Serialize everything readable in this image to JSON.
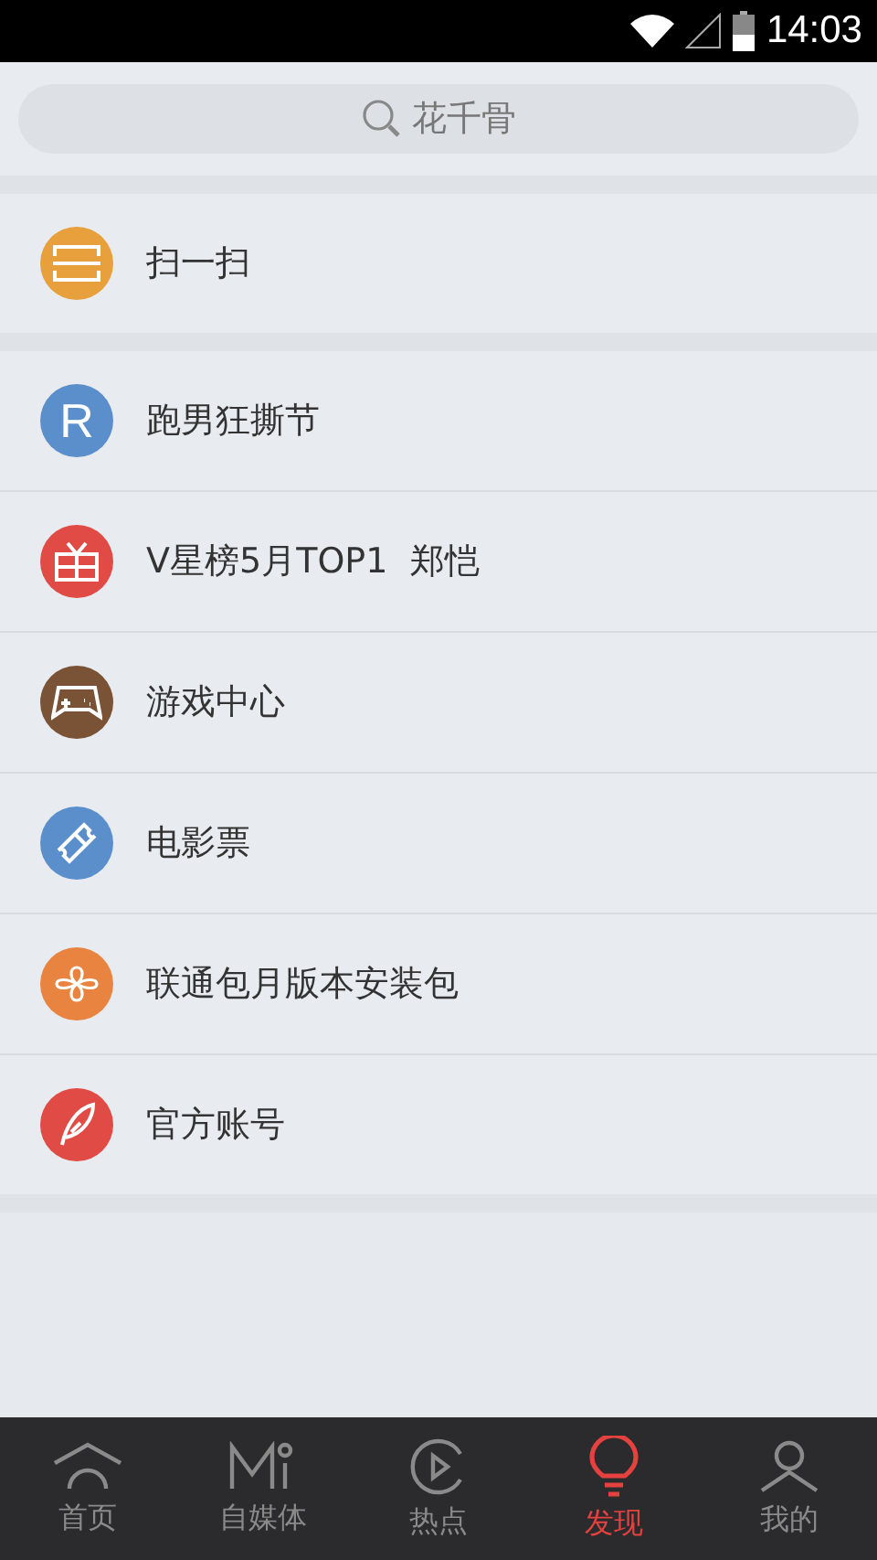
{
  "status_bar": {
    "time": "14:03"
  },
  "search": {
    "placeholder": "花千骨"
  },
  "sections": [
    {
      "items": [
        {
          "kind": "scan",
          "label": "扫一扫",
          "color": "#e8a03c"
        }
      ]
    },
    {
      "items": [
        {
          "kind": "letter",
          "badge": "R",
          "label": "跑男狂撕节",
          "color": "#5b8fcb"
        },
        {
          "kind": "gift",
          "label": "V星榜5月TOP1  郑恺",
          "color": "#e04b45"
        },
        {
          "kind": "gamepad",
          "label": "游戏中心",
          "color": "#7a5336"
        },
        {
          "kind": "ticket",
          "label": "电影票",
          "color": "#5b8fcb"
        },
        {
          "kind": "knot",
          "label": "联通包月版本安装包",
          "color": "#e8843f"
        },
        {
          "kind": "feather",
          "label": "官方账号",
          "color": "#e04b45"
        }
      ]
    }
  ],
  "tab_bar": [
    {
      "kind": "home",
      "label": "首页",
      "selected": false
    },
    {
      "kind": "media",
      "label": "自媒体",
      "selected": false
    },
    {
      "kind": "play",
      "label": "热点",
      "selected": false
    },
    {
      "kind": "bulb",
      "label": "发现",
      "selected": true
    },
    {
      "kind": "person",
      "label": "我的",
      "selected": false
    }
  ]
}
